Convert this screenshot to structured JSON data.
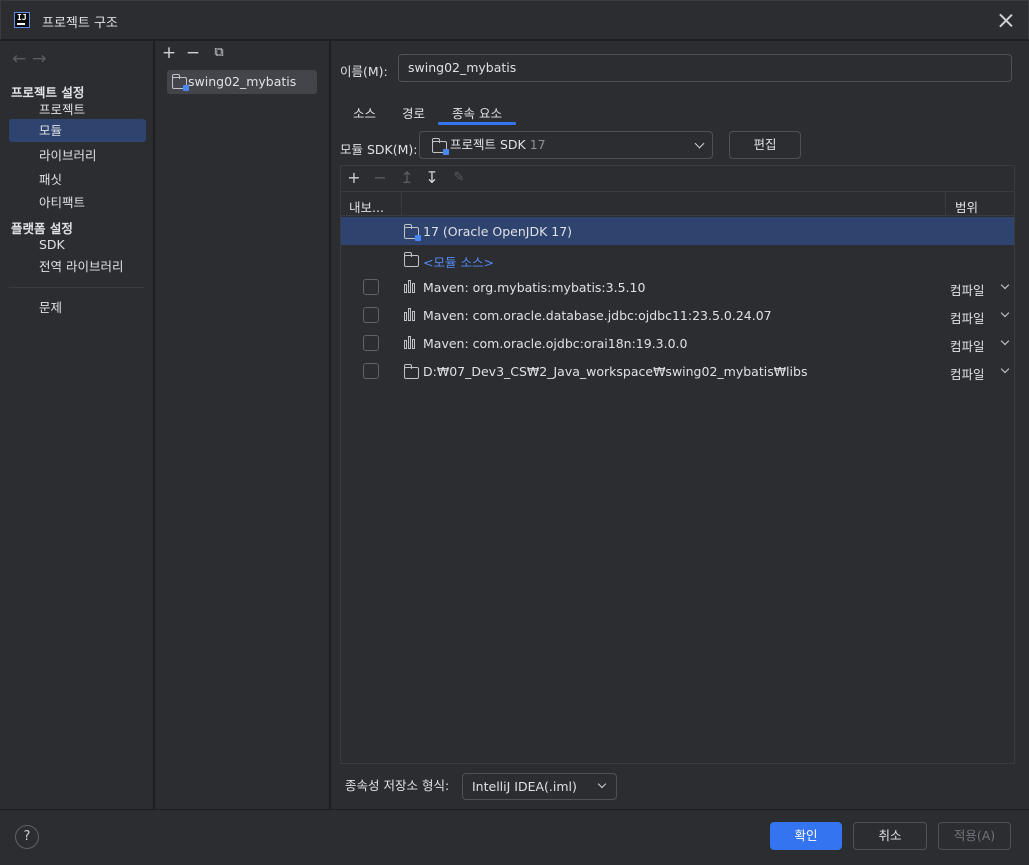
{
  "window": {
    "title": "프로젝트 구조",
    "close_label": ""
  },
  "sidebar": {
    "project_settings_header": "프로젝트 설정",
    "project_items": [
      "프로젝트",
      "모듈",
      "라이브러리",
      "패싯",
      "아티팩트"
    ],
    "platform_settings_header": "플랫폼 설정",
    "platform_items": [
      "SDK",
      "전역 라이브러리"
    ],
    "problems": "문제",
    "selected": "모듈"
  },
  "modules": {
    "items": [
      "swing02_mybatis"
    ]
  },
  "main": {
    "name_label": "이름(M):",
    "name_value": "swing02_mybatis",
    "tabs": [
      "소스",
      "경로",
      "종속 요소"
    ],
    "active_tab": "종속 요소",
    "sdk_label": "모듈 SDK(M):",
    "sdk_value": "프로젝트 SDK",
    "sdk_version": "17",
    "edit_button": "편집",
    "columns": {
      "export": "내보...",
      "scope": "범위"
    },
    "dependencies": [
      {
        "text": "17 (Oracle OpenJDK 17)",
        "type": "sdk",
        "scope": "",
        "checkbox": false,
        "selected": true
      },
      {
        "text": "<모듈 소스>",
        "type": "source",
        "scope": "",
        "checkbox": false,
        "selected": false
      },
      {
        "text": "Maven: org.mybatis:mybatis:3.5.10",
        "type": "library",
        "scope": "컴파일",
        "checkbox": true,
        "selected": false
      },
      {
        "text": "Maven: com.oracle.database.jdbc:ojdbc11:23.5.0.24.07",
        "type": "library",
        "scope": "컴파일",
        "checkbox": true,
        "selected": false
      },
      {
        "text": "Maven: com.oracle.ojdbc:orai18n:19.3.0.0",
        "type": "library",
        "scope": "컴파일",
        "checkbox": true,
        "selected": false
      },
      {
        "text": "D:₩07_Dev3_CS₩2_Java_workspace₩swing02_mybatis₩libs",
        "type": "folder",
        "scope": "컴파일",
        "checkbox": true,
        "selected": false
      }
    ],
    "storage_label": "종속성 저장소 형식:",
    "storage_value": "IntelliJ IDEA(.iml)"
  },
  "footer": {
    "help": "?",
    "ok": "확인",
    "cancel": "취소",
    "apply": "적용(A)"
  },
  "colors": {
    "accent": "#3574f0",
    "selection": "#2e436e",
    "background": "#2b2d30",
    "link": "#548af7"
  }
}
